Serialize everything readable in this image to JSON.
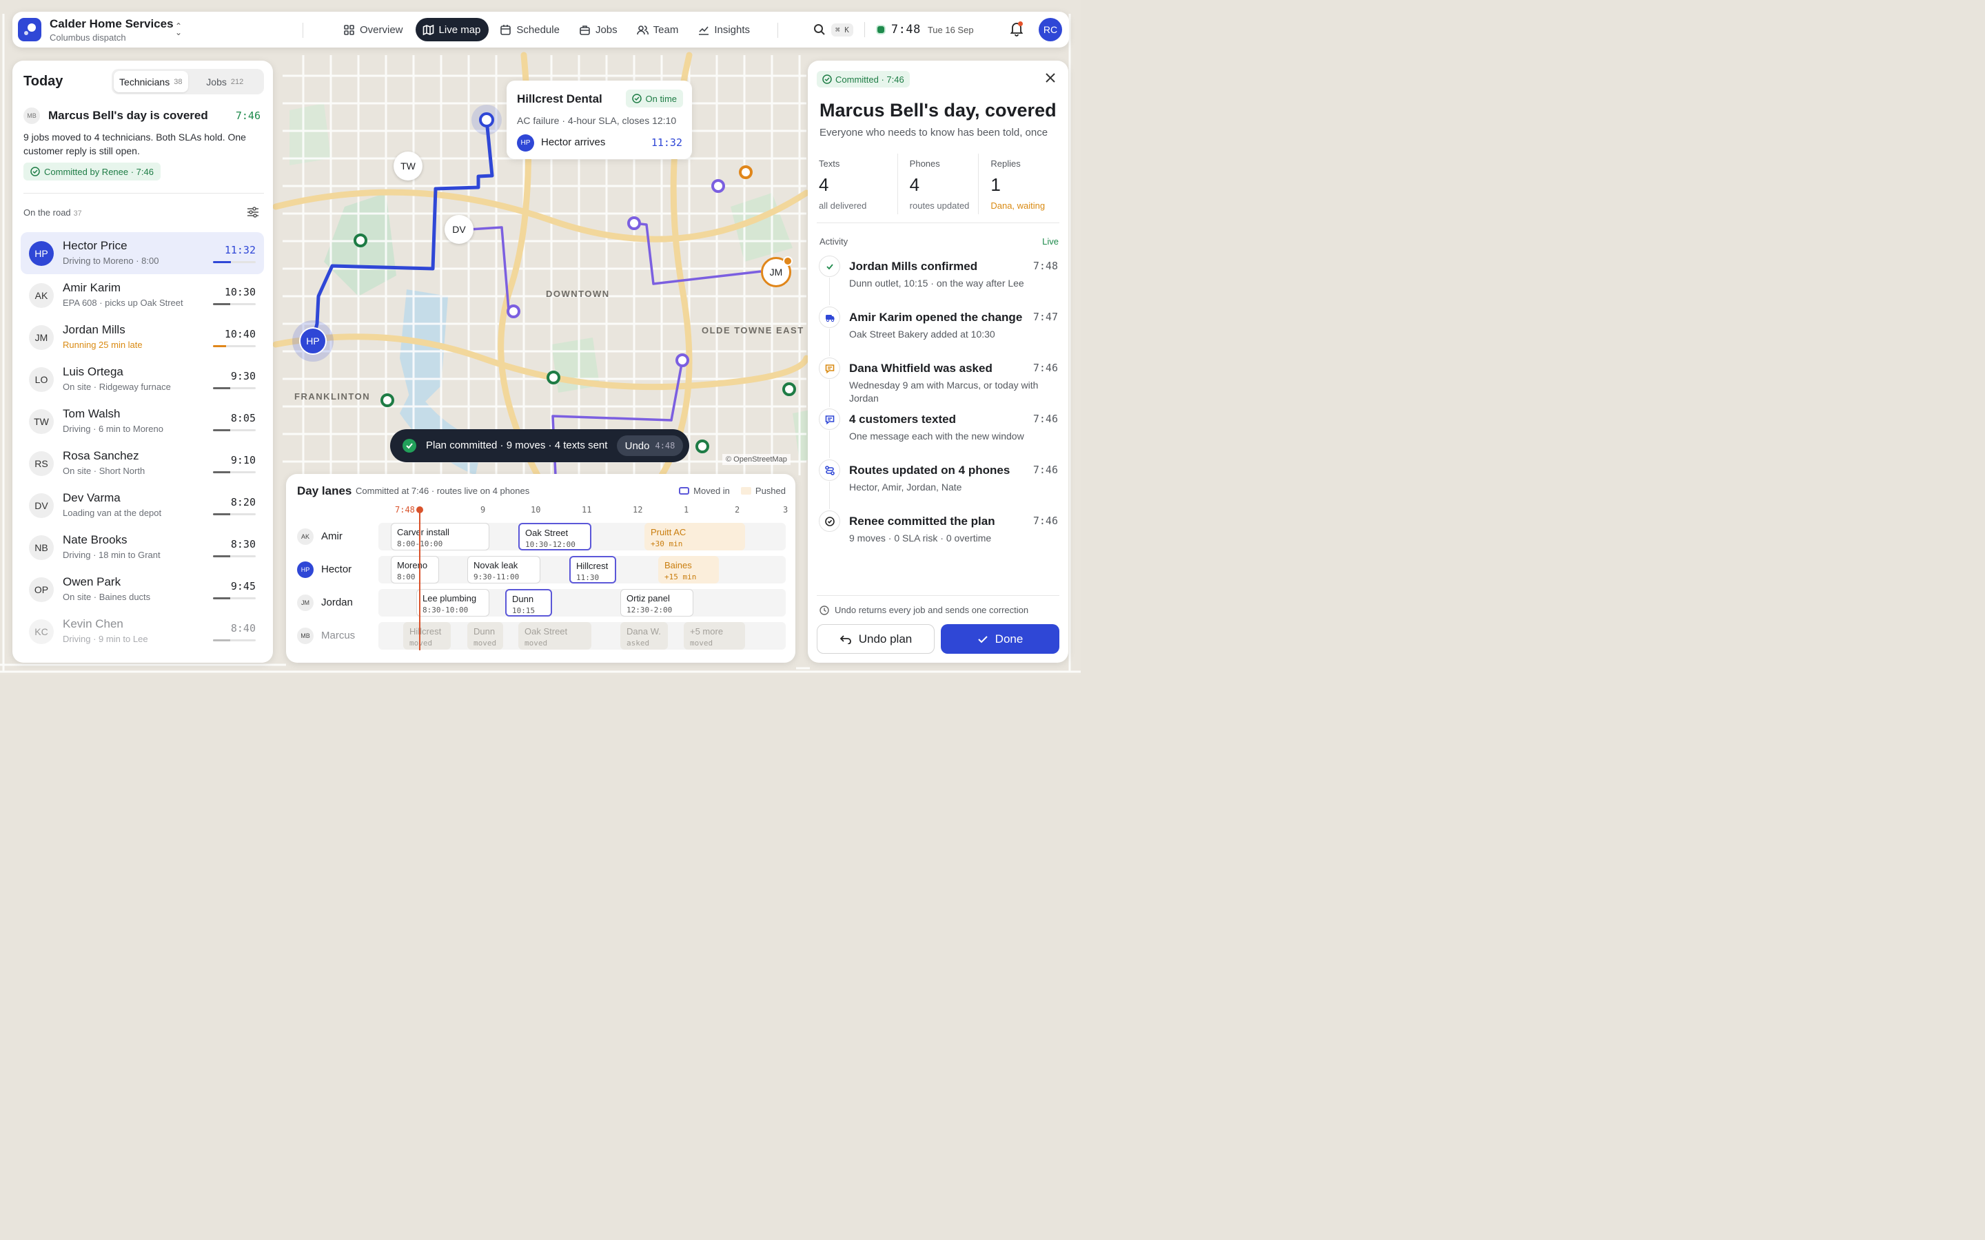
{
  "brand": {
    "title": "Calder Home Services",
    "subtitle": "Columbus dispatch"
  },
  "nav": [
    {
      "label": "Overview",
      "icon": "grid-icon"
    },
    {
      "label": "Live map",
      "icon": "map-icon",
      "active": true
    },
    {
      "label": "Schedule",
      "icon": "calendar-icon"
    },
    {
      "label": "Jobs",
      "icon": "briefcase-icon"
    },
    {
      "label": "Team",
      "icon": "people-icon"
    },
    {
      "label": "Insights",
      "icon": "chart-icon"
    }
  ],
  "topbar": {
    "shortcut": "⌘ K",
    "time": "7:48",
    "date": "Tue 16 Sep",
    "user_initials": "RC"
  },
  "left": {
    "title": "Today",
    "tabs": [
      {
        "label": "Technicians",
        "count": "38"
      },
      {
        "label": "Jobs",
        "count": "212"
      }
    ],
    "summary": {
      "avatar": "MB",
      "title": "Marcus Bell's day is covered",
      "time": "7:46",
      "text": "9 jobs moved to 4 technicians. Both SLAs hold. One customer reply is still open.",
      "badge": "Committed by Renee · 7:46"
    },
    "road_label": "On the road",
    "road_count": "37",
    "technicians": [
      {
        "initials": "HP",
        "name": "Hector Price",
        "status": "Driving to Moreno · 8:00",
        "time": "11:32",
        "progress": 0.42,
        "selected": true
      },
      {
        "initials": "AK",
        "name": "Amir Karim",
        "status": "EPA 608 · picks up Oak Street",
        "time": "10:30",
        "progress": 0.4
      },
      {
        "initials": "JM",
        "name": "Jordan Mills",
        "status": "Running 25 min late",
        "time": "10:40",
        "progress": 0.3,
        "warn": true
      },
      {
        "initials": "LO",
        "name": "Luis Ortega",
        "status": "On site · Ridgeway furnace",
        "time": "9:30",
        "progress": 0.4
      },
      {
        "initials": "TW",
        "name": "Tom Walsh",
        "status": "Driving · 6 min to Moreno",
        "time": "8:05",
        "progress": 0.4
      },
      {
        "initials": "RS",
        "name": "Rosa Sanchez",
        "status": "On site · Short North",
        "time": "9:10",
        "progress": 0.4
      },
      {
        "initials": "DV",
        "name": "Dev Varma",
        "status": "Loading van at the depot",
        "time": "8:20",
        "progress": 0.4
      },
      {
        "initials": "NB",
        "name": "Nate Brooks",
        "status": "Driving · 18 min to Grant",
        "time": "8:30",
        "progress": 0.4
      },
      {
        "initials": "OP",
        "name": "Owen Park",
        "status": "On site · Baines ducts",
        "time": "9:45",
        "progress": 0.4
      },
      {
        "initials": "KC",
        "name": "Kevin Chen",
        "status": "Driving · 9 min to Lee",
        "time": "8:40",
        "progress": 0.4,
        "faded": true
      }
    ]
  },
  "map": {
    "labels": {
      "downtown": "DOWNTOWN",
      "olde": "OLDE TOWNE EAST",
      "franklinton": "FRANKLINTON"
    },
    "credit": "© OpenStreetMap",
    "markers": {
      "tw": "TW",
      "dv": "DV",
      "jm": "JM",
      "hp": "HP"
    },
    "tooltip": {
      "title": "Hillcrest Dental",
      "badge": "On time",
      "sub": "AC failure · 4-hour SLA, closes 12:10",
      "avatar": "HP",
      "who": "Hector arrives",
      "time": "11:32"
    }
  },
  "toast": {
    "message": "Plan committed · 9 moves · 4 texts sent",
    "undo": "Undo",
    "countdown": "4:48"
  },
  "lanes": {
    "title": "Day lanes",
    "subtitle": "Committed at 7:46 · routes live on 4 phones",
    "legend": {
      "moved": "Moved in",
      "pushed": "Pushed"
    },
    "axis": {
      "now": "7:48",
      "ticks": [
        "9",
        "10",
        "11",
        "12",
        "1",
        "2",
        "3"
      ]
    },
    "rows": [
      {
        "initials": "AK",
        "name": "Amir",
        "blocks": [
          {
            "title": "Carver install",
            "time": "8:00-10:00",
            "kind": "normal"
          },
          {
            "title": "Oak Street",
            "time": "10:30-12:00",
            "kind": "moved"
          },
          {
            "title": "Pruitt AC",
            "time": "+30 min",
            "kind": "pushed"
          }
        ]
      },
      {
        "initials": "HP",
        "name": "Hector",
        "blocks": [
          {
            "title": "Moreno",
            "time": "8:00",
            "kind": "normal"
          },
          {
            "title": "Novak leak",
            "time": "9:30-11:00",
            "kind": "normal"
          },
          {
            "title": "Hillcrest",
            "time": "11:30",
            "kind": "moved"
          },
          {
            "title": "Baines",
            "time": "+15 min",
            "kind": "pushed"
          }
        ]
      },
      {
        "initials": "JM",
        "name": "Jordan",
        "blocks": [
          {
            "title": "Lee plumbing",
            "time": "8:30-10:00",
            "kind": "normal"
          },
          {
            "title": "Dunn",
            "time": "10:15",
            "kind": "moved"
          },
          {
            "title": "Ortiz panel",
            "time": "12:30-2:00",
            "kind": "normal"
          }
        ]
      },
      {
        "initials": "MB",
        "name": "Marcus",
        "faded": true,
        "blocks": [
          {
            "title": "Hillcrest",
            "time": "moved",
            "kind": "ghost"
          },
          {
            "title": "Dunn",
            "time": "moved",
            "kind": "ghost"
          },
          {
            "title": "Oak Street",
            "time": "moved",
            "kind": "ghost"
          },
          {
            "title": "Dana W.",
            "time": "asked",
            "kind": "ghost"
          },
          {
            "title": "+5 more",
            "time": "moved",
            "kind": "ghost"
          }
        ]
      }
    ]
  },
  "right": {
    "badge": "Committed · 7:46",
    "title": "Marcus Bell's day, covered",
    "subtitle": "Everyone who needs to know has been told, once",
    "stats": [
      {
        "label": "Texts",
        "value": "4",
        "detail": "all delivered"
      },
      {
        "label": "Phones",
        "value": "4",
        "detail": "routes updated"
      },
      {
        "label": "Replies",
        "value": "1",
        "detail": "Dana, waiting",
        "warn": true
      }
    ],
    "activity_label": "Activity",
    "activity_live": "Live",
    "activity": [
      {
        "icon": "check-icon",
        "title": "Jordan Mills confirmed",
        "detail": "Dunn outlet, 10:15 · on the way after Lee",
        "time": "7:48"
      },
      {
        "icon": "van-icon",
        "title": "Amir Karim opened the change",
        "detail": "Oak Street Bakery added at 10:30",
        "time": "7:47"
      },
      {
        "icon": "chat-icon",
        "title": "Dana Whitfield was asked",
        "detail": "Wednesday 9 am with Marcus, or today with Jordan",
        "time": "7:46"
      },
      {
        "icon": "message-icon",
        "title": "4 customers texted",
        "detail": "One message each with the new window",
        "time": "7:46"
      },
      {
        "icon": "route-icon",
        "title": "Routes updated on 4 phones",
        "detail": "Hector, Amir, Jordan, Nate",
        "time": "7:46"
      },
      {
        "icon": "check-circle-icon",
        "title": "Renee committed the plan",
        "detail": "9 moves · 0 SLA risk · 0 overtime",
        "time": "7:46"
      }
    ],
    "footer_note": "Undo returns every job and sends one correction",
    "undo_button": "Undo plan",
    "done_button": "Done"
  }
}
